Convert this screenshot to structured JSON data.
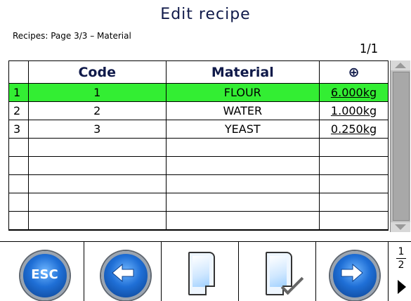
{
  "header": {
    "title": "Edit recipe",
    "subtitle": "Recipes: Page 3/3 – Material",
    "page": "1/1"
  },
  "table": {
    "columns": [
      "",
      "Code",
      "Material",
      "⊕"
    ],
    "rows": [
      {
        "idx": "1",
        "code": "1",
        "material": "FLOUR",
        "qty": "6.000kg"
      },
      {
        "idx": "2",
        "code": "2",
        "material": "WATER",
        "qty": "1.000kg"
      },
      {
        "idx": "3",
        "code": "3",
        "material": "YEAST",
        "qty": "0.250kg"
      }
    ],
    "selected_row": 1
  },
  "softkeys": {
    "esc_label": "ESC",
    "page_top": "1",
    "page_bottom": "2"
  },
  "colors": {
    "selected_row": "#33ee33",
    "title": "#101a4a"
  },
  "icons": [
    "esc-icon",
    "arrow-left-icon",
    "new-document-icon",
    "edit-document-icon",
    "arrow-right-icon",
    "next-page-icon"
  ]
}
